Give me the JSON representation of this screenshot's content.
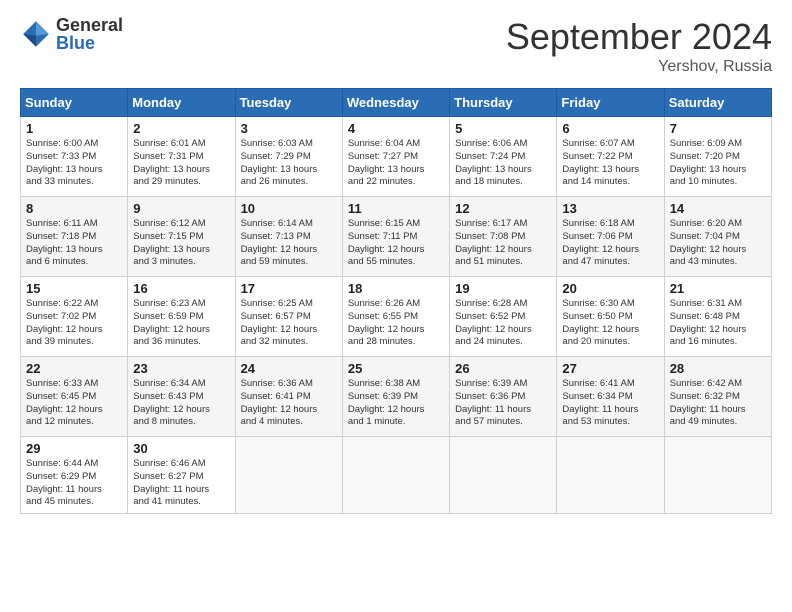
{
  "header": {
    "logo_general": "General",
    "logo_blue": "Blue",
    "title": "September 2024",
    "location": "Yershov, Russia"
  },
  "weekdays": [
    "Sunday",
    "Monday",
    "Tuesday",
    "Wednesday",
    "Thursday",
    "Friday",
    "Saturday"
  ],
  "weeks": [
    [
      {
        "day": "1",
        "info": "Sunrise: 6:00 AM\nSunset: 7:33 PM\nDaylight: 13 hours\nand 33 minutes."
      },
      {
        "day": "2",
        "info": "Sunrise: 6:01 AM\nSunset: 7:31 PM\nDaylight: 13 hours\nand 29 minutes."
      },
      {
        "day": "3",
        "info": "Sunrise: 6:03 AM\nSunset: 7:29 PM\nDaylight: 13 hours\nand 26 minutes."
      },
      {
        "day": "4",
        "info": "Sunrise: 6:04 AM\nSunset: 7:27 PM\nDaylight: 13 hours\nand 22 minutes."
      },
      {
        "day": "5",
        "info": "Sunrise: 6:06 AM\nSunset: 7:24 PM\nDaylight: 13 hours\nand 18 minutes."
      },
      {
        "day": "6",
        "info": "Sunrise: 6:07 AM\nSunset: 7:22 PM\nDaylight: 13 hours\nand 14 minutes."
      },
      {
        "day": "7",
        "info": "Sunrise: 6:09 AM\nSunset: 7:20 PM\nDaylight: 13 hours\nand 10 minutes."
      }
    ],
    [
      {
        "day": "8",
        "info": "Sunrise: 6:11 AM\nSunset: 7:18 PM\nDaylight: 13 hours\nand 6 minutes."
      },
      {
        "day": "9",
        "info": "Sunrise: 6:12 AM\nSunset: 7:15 PM\nDaylight: 13 hours\nand 3 minutes."
      },
      {
        "day": "10",
        "info": "Sunrise: 6:14 AM\nSunset: 7:13 PM\nDaylight: 12 hours\nand 59 minutes."
      },
      {
        "day": "11",
        "info": "Sunrise: 6:15 AM\nSunset: 7:11 PM\nDaylight: 12 hours\nand 55 minutes."
      },
      {
        "day": "12",
        "info": "Sunrise: 6:17 AM\nSunset: 7:08 PM\nDaylight: 12 hours\nand 51 minutes."
      },
      {
        "day": "13",
        "info": "Sunrise: 6:18 AM\nSunset: 7:06 PM\nDaylight: 12 hours\nand 47 minutes."
      },
      {
        "day": "14",
        "info": "Sunrise: 6:20 AM\nSunset: 7:04 PM\nDaylight: 12 hours\nand 43 minutes."
      }
    ],
    [
      {
        "day": "15",
        "info": "Sunrise: 6:22 AM\nSunset: 7:02 PM\nDaylight: 12 hours\nand 39 minutes."
      },
      {
        "day": "16",
        "info": "Sunrise: 6:23 AM\nSunset: 6:59 PM\nDaylight: 12 hours\nand 36 minutes."
      },
      {
        "day": "17",
        "info": "Sunrise: 6:25 AM\nSunset: 6:57 PM\nDaylight: 12 hours\nand 32 minutes."
      },
      {
        "day": "18",
        "info": "Sunrise: 6:26 AM\nSunset: 6:55 PM\nDaylight: 12 hours\nand 28 minutes."
      },
      {
        "day": "19",
        "info": "Sunrise: 6:28 AM\nSunset: 6:52 PM\nDaylight: 12 hours\nand 24 minutes."
      },
      {
        "day": "20",
        "info": "Sunrise: 6:30 AM\nSunset: 6:50 PM\nDaylight: 12 hours\nand 20 minutes."
      },
      {
        "day": "21",
        "info": "Sunrise: 6:31 AM\nSunset: 6:48 PM\nDaylight: 12 hours\nand 16 minutes."
      }
    ],
    [
      {
        "day": "22",
        "info": "Sunrise: 6:33 AM\nSunset: 6:45 PM\nDaylight: 12 hours\nand 12 minutes."
      },
      {
        "day": "23",
        "info": "Sunrise: 6:34 AM\nSunset: 6:43 PM\nDaylight: 12 hours\nand 8 minutes."
      },
      {
        "day": "24",
        "info": "Sunrise: 6:36 AM\nSunset: 6:41 PM\nDaylight: 12 hours\nand 4 minutes."
      },
      {
        "day": "25",
        "info": "Sunrise: 6:38 AM\nSunset: 6:39 PM\nDaylight: 12 hours\nand 1 minute."
      },
      {
        "day": "26",
        "info": "Sunrise: 6:39 AM\nSunset: 6:36 PM\nDaylight: 11 hours\nand 57 minutes."
      },
      {
        "day": "27",
        "info": "Sunrise: 6:41 AM\nSunset: 6:34 PM\nDaylight: 11 hours\nand 53 minutes."
      },
      {
        "day": "28",
        "info": "Sunrise: 6:42 AM\nSunset: 6:32 PM\nDaylight: 11 hours\nand 49 minutes."
      }
    ],
    [
      {
        "day": "29",
        "info": "Sunrise: 6:44 AM\nSunset: 6:29 PM\nDaylight: 11 hours\nand 45 minutes."
      },
      {
        "day": "30",
        "info": "Sunrise: 6:46 AM\nSunset: 6:27 PM\nDaylight: 11 hours\nand 41 minutes."
      },
      null,
      null,
      null,
      null,
      null
    ]
  ]
}
